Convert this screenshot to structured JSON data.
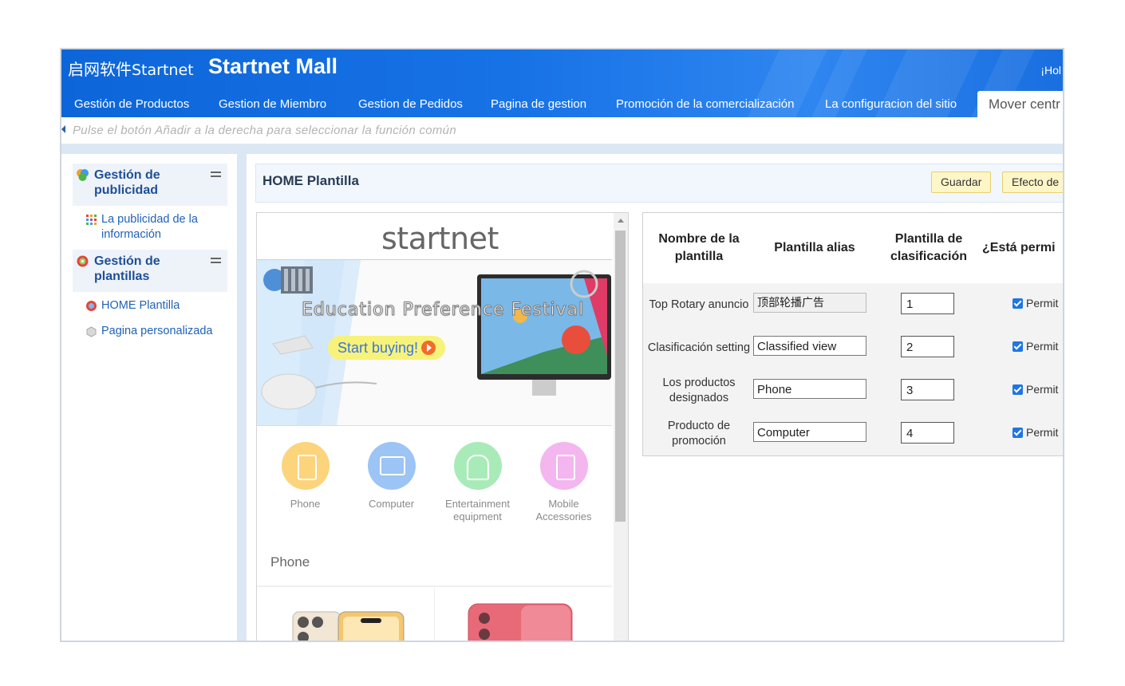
{
  "header": {
    "logo_cn": "启网软件",
    "logo_brand": "Startnet",
    "site_title": "Startnet Mall",
    "greeting": "¡Hol",
    "nav": [
      {
        "label": "Gestión de Productos"
      },
      {
        "label": "Gestion de Miembro"
      },
      {
        "label": "Gestion de Pedidos"
      },
      {
        "label": "Pagina de gestion"
      },
      {
        "label": "Promoción de la comercialización"
      },
      {
        "label": "La configuracion del sitio"
      },
      {
        "label": "Mover centr"
      }
    ]
  },
  "hint": "Pulse el botón Añadir a la derecha para seleccionar la función común",
  "sidebar": {
    "sections": [
      {
        "title": "Gestión de publicidad",
        "links": [
          {
            "label": "La publicidad de la información"
          }
        ]
      },
      {
        "title": "Gestión de plantillas",
        "links": [
          {
            "label": "HOME Plantilla"
          },
          {
            "label": "Pagina personalizada"
          }
        ]
      }
    ]
  },
  "panel": {
    "title": "HOME Plantilla",
    "buttons": {
      "save": "Guardar",
      "effect": "Efecto de"
    }
  },
  "preview": {
    "brand": "startnet",
    "banner_title": "Education Preference Festival",
    "banner_button": "Start buying!",
    "categories": [
      {
        "label": "Phone",
        "color": "#fbd47c"
      },
      {
        "label": "Computer",
        "color": "#9cc4f5"
      },
      {
        "label": "Entertainment equipment",
        "color": "#a9ebb8"
      },
      {
        "label": "Mobile Accessories",
        "color": "#f3b6ef"
      }
    ],
    "section_title": "Phone"
  },
  "table": {
    "headers": [
      "Nombre de la plantilla",
      "Plantilla alias",
      "Plantilla de clasificación",
      "¿Está permi"
    ],
    "rows": [
      {
        "name": "Top Rotary anuncio",
        "alias": "顶部轮播广告",
        "order": "1",
        "permit": "Permit"
      },
      {
        "name": "Clasificación setting",
        "alias": "Classified view",
        "order": "2",
        "permit": "Permit"
      },
      {
        "name": "Los productos designados",
        "alias": "Phone",
        "order": "3",
        "permit": "Permit"
      },
      {
        "name": "Producto de promoción",
        "alias": "Computer",
        "order": "4",
        "permit": "Permit"
      }
    ]
  },
  "colors": {
    "header_blue": "#1772e6",
    "link_blue": "#1f62b8",
    "button_yellow": "#fff6c8",
    "checkbox_blue": "#1e76e3"
  }
}
